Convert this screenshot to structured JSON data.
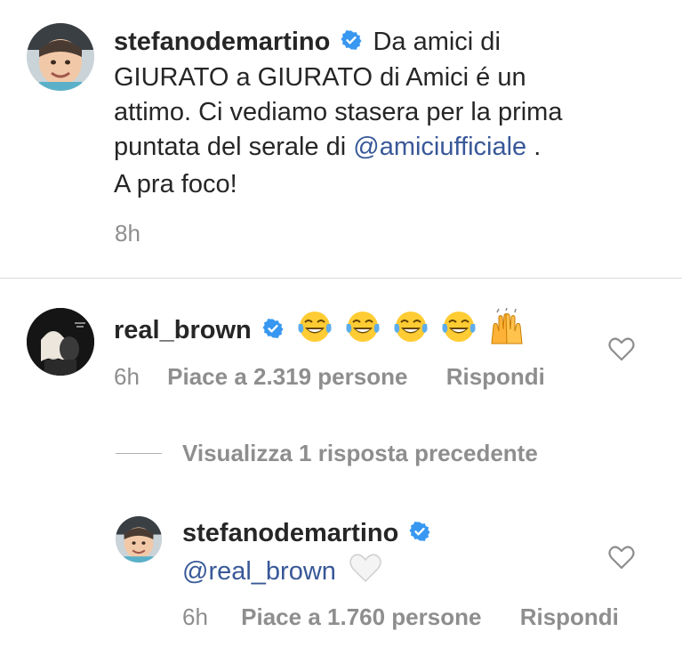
{
  "caption": {
    "username": "stefanodemartino",
    "text_part1": "Da amici di",
    "line2": "GIURATO a GIURATO di Amici é un",
    "line3": "attimo. Ci vediamo stasera per la prima",
    "line4_prefix": "puntata del serale di ",
    "mention": "@amiciufficiale",
    "line4_suffix": " .",
    "line5": "A pra foco!",
    "time": "8h"
  },
  "comment1": {
    "username": "real_brown",
    "emojis": [
      "face-with-tears-of-joy",
      "face-with-tears-of-joy",
      "face-with-tears-of-joy",
      "face-with-tears-of-joy",
      "raising-hands"
    ],
    "time": "6h",
    "likes": "Piace a 2.319 persone",
    "reply": "Rispondi"
  },
  "view_replies": "Visualizza 1 risposta precedente",
  "reply1": {
    "username": "stefanodemartino",
    "mention": "@real_brown",
    "emoji": "white-heart",
    "time": "6h",
    "likes": "Piace a 1.760 persone",
    "reply": "Rispondi"
  },
  "colors": {
    "verified": "#3897f0",
    "mention": "#385898",
    "meta": "#8e8e8e",
    "text": "#262626"
  }
}
